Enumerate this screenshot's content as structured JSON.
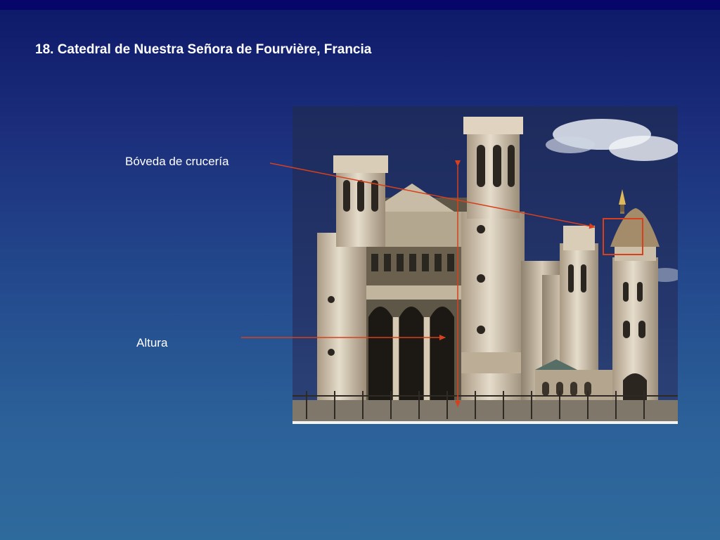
{
  "slide": {
    "title": "18. Catedral de Nuestra Señora de Fourvière, Francia"
  },
  "annotations": {
    "vault_label": "Bóveda de crucería",
    "height_label": "Altura"
  },
  "colors": {
    "annotation_red": "#d8401c",
    "title_text": "#ffffff"
  }
}
